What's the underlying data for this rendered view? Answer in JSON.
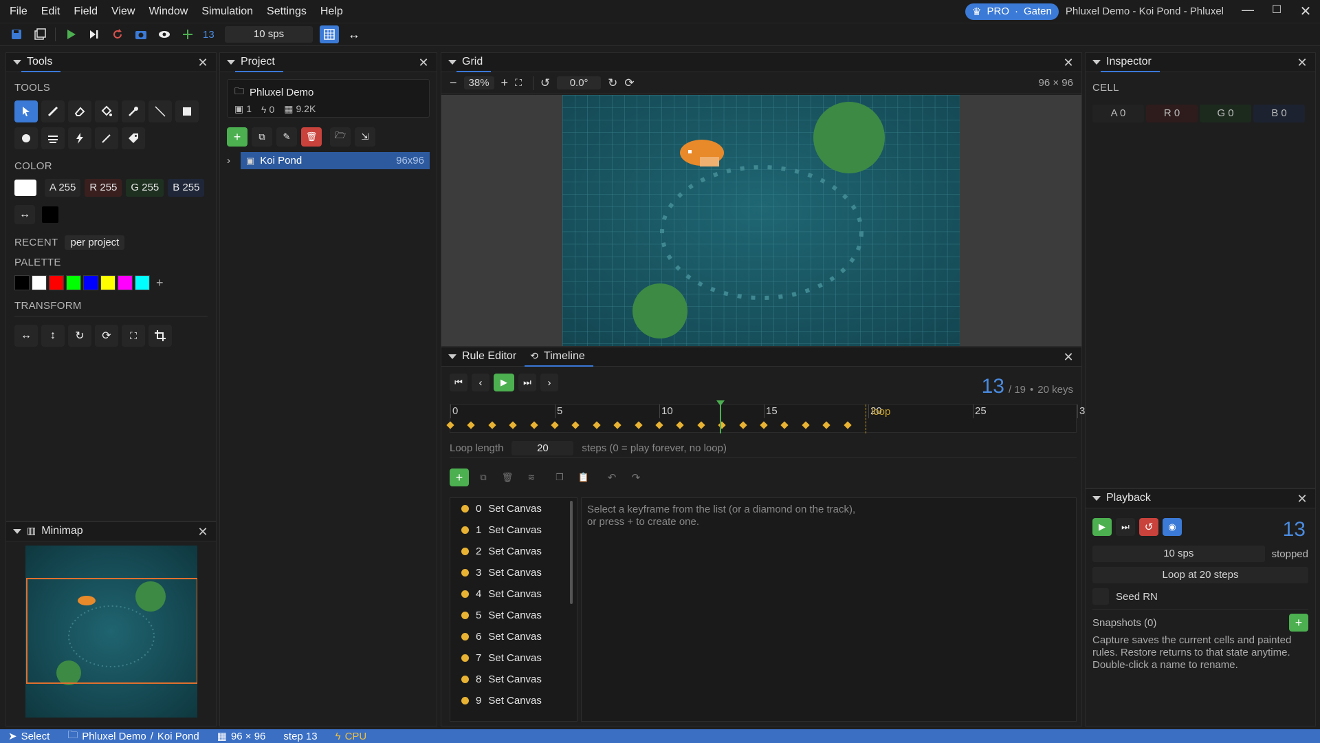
{
  "menu": [
    "File",
    "Edit",
    "Field",
    "View",
    "Window",
    "Simulation",
    "Settings",
    "Help"
  ],
  "title_badge": {
    "tier": "PRO",
    "user": "Gaten"
  },
  "window_title": "Phluxel Demo - Koi Pond - Phluxel",
  "toolbar": {
    "step": "13",
    "sps": "10 sps"
  },
  "tools": {
    "title": "Tools",
    "section_tools": "TOOLS",
    "section_color": "COLOR",
    "color": {
      "a": "A 255",
      "r": "R 255",
      "g": "G 255",
      "b": "B 255"
    },
    "recent_label": "RECENT",
    "recent_scope": "per project",
    "palette_label": "PALETTE",
    "palette": [
      "#000000",
      "#ffffff",
      "#ff0000",
      "#00ff00",
      "#0000ff",
      "#ffff00",
      "#ff00ff",
      "#00ffff"
    ],
    "transform_label": "TRANSFORM"
  },
  "minimap": {
    "title": "Minimap"
  },
  "project": {
    "title": "Project",
    "name": "Phluxel Demo",
    "stats": {
      "images": "1",
      "rules": "0",
      "size": "9.2K"
    },
    "item": {
      "label": "Koi Pond",
      "size": "96x96"
    }
  },
  "grid": {
    "title": "Grid",
    "zoom": "38%",
    "rotation": "0.0°",
    "dims": "96 × 96"
  },
  "timeline": {
    "tab_rule_editor": "Rule Editor",
    "tab_timeline": "Timeline",
    "current": "13",
    "total": "/ 19",
    "keys": "20 keys",
    "ruler": [
      "0",
      "5",
      "10",
      "15",
      "20",
      "25",
      "3"
    ],
    "loop_marker": "loop",
    "loop_length_label": "Loop length",
    "loop_length": "20",
    "loop_hint": "steps (0 = play forever, no loop)",
    "keyframes": [
      {
        "index": "0",
        "label": "Set Canvas"
      },
      {
        "index": "1",
        "label": "Set Canvas"
      },
      {
        "index": "2",
        "label": "Set Canvas"
      },
      {
        "index": "3",
        "label": "Set Canvas"
      },
      {
        "index": "4",
        "label": "Set Canvas"
      },
      {
        "index": "5",
        "label": "Set Canvas"
      },
      {
        "index": "6",
        "label": "Set Canvas"
      },
      {
        "index": "7",
        "label": "Set Canvas"
      },
      {
        "index": "8",
        "label": "Set Canvas"
      },
      {
        "index": "9",
        "label": "Set Canvas"
      }
    ],
    "empty_hint_1": "Select a keyframe from the list (or a diamond on the track),",
    "empty_hint_2": "or press + to create one."
  },
  "inspector": {
    "title": "Inspector",
    "cell_label": "CELL",
    "a": "A 0",
    "r": "R 0",
    "g": "G 0",
    "b": "B 0"
  },
  "playback": {
    "title": "Playback",
    "step": "13",
    "sps": "10 sps",
    "state": "stopped",
    "loop": "Loop at 20 steps",
    "seed": "Seed RN",
    "snapshots": "Snapshots (0)",
    "help": "Capture saves the current cells and painted rules. Restore returns to that state anytime. Double-click a name to rename."
  },
  "status": {
    "tool": "Select",
    "path_project": "Phluxel Demo",
    "path_sep": "/",
    "path_item": "Koi Pond",
    "dims": "96 × 96",
    "step": "step 13",
    "backend": "CPU"
  },
  "colors": {
    "accent": "#3a78d8",
    "play": "#4caf50",
    "reset": "#d9534f",
    "keyframe": "#e8b233",
    "pond": "#17535e",
    "koi": "#e8892a",
    "lily": "#3d8a44"
  }
}
